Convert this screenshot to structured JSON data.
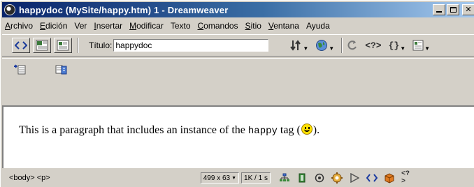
{
  "window": {
    "title": "happydoc (MySite/happy.htm) 1 - Dreamweaver"
  },
  "menu": {
    "items": [
      {
        "u": "A",
        "rest": "rchivo"
      },
      {
        "u": "E",
        "rest": "dición"
      },
      {
        "u": "Ver",
        "rest": "",
        "pre": ""
      },
      {
        "u": "I",
        "rest": "nsertar"
      },
      {
        "u": "M",
        "rest": "odificar"
      },
      {
        "u": "T",
        "rest": "exto"
      },
      {
        "u": "C",
        "rest": "omandos"
      },
      {
        "u": "S",
        "rest": "itio"
      },
      {
        "u": "V",
        "rest": "entana"
      },
      {
        "u": "",
        "rest": "Ayuda"
      }
    ],
    "labels": [
      "Archivo",
      "Edición",
      "Ver",
      "Insertar",
      "Modificar",
      "Texto",
      "Comandos",
      "Sitio",
      "Ventana",
      "Ayuda"
    ]
  },
  "toolbar": {
    "title_label": "Título:",
    "title_value": "happydoc"
  },
  "document": {
    "text_before": "This is a paragraph that includes an instance of the ",
    "tag_name": "happy",
    "text_after_tag": " tag (",
    "text_end": ")."
  },
  "status": {
    "tag_selector": "<body> <p>",
    "window_size": "499 x 63",
    "download": "1K / 1 s"
  }
}
